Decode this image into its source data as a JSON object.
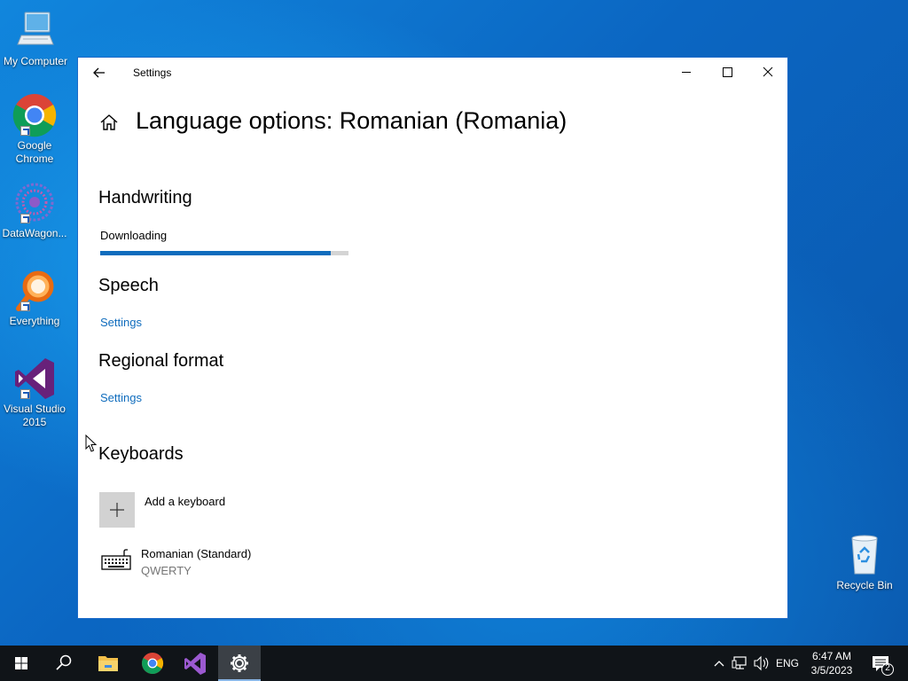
{
  "desktop_icons": [
    {
      "name": "desktop-icon-my-computer",
      "icon": "computer-icon",
      "label": "My Computer"
    },
    {
      "name": "desktop-icon-chrome",
      "icon": "chrome-icon",
      "label": "Google Chrome"
    },
    {
      "name": "desktop-icon-datawagon",
      "icon": "datawagon-icon",
      "label": "DataWagon..."
    },
    {
      "name": "desktop-icon-everything",
      "icon": "everything-icon",
      "label": "Everything"
    },
    {
      "name": "desktop-icon-visual-studio",
      "icon": "visual-studio-icon",
      "label": "Visual Studio 2015"
    },
    {
      "name": "desktop-icon-recycle-bin",
      "icon": "recycle-bin-icon",
      "label": "Recycle Bin"
    }
  ],
  "window": {
    "title": "Settings",
    "page_title": "Language options: Romanian (Romania)"
  },
  "handwriting": {
    "heading": "Handwriting",
    "status": "Downloading",
    "progress": 0.93
  },
  "speech": {
    "heading": "Speech",
    "link": "Settings"
  },
  "regional": {
    "heading": "Regional format",
    "link": "Settings"
  },
  "keyboards": {
    "heading": "Keyboards",
    "add_label": "Add a keyboard",
    "items": [
      {
        "name": "Romanian (Standard)",
        "layout": "QWERTY"
      }
    ]
  },
  "taskbar": {
    "language": "ENG",
    "time": "6:47 AM",
    "date": "3/5/2023",
    "notification_count": "2"
  },
  "colors": {
    "accent": "#0f6cbd",
    "taskbar": "#101418"
  }
}
